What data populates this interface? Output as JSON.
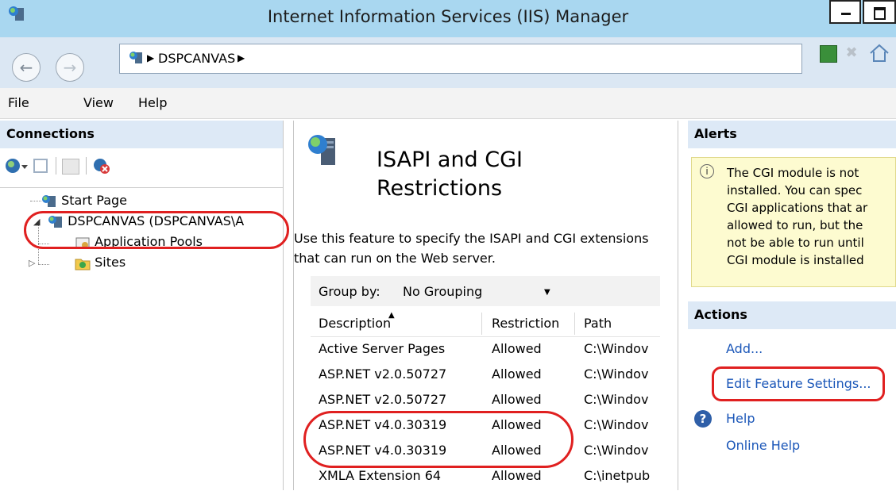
{
  "window": {
    "title": "Internet Information Services (IIS) Manager"
  },
  "address": {
    "segment": "DSPCANVAS"
  },
  "menu": [
    "File",
    "View",
    "Help"
  ],
  "connections": {
    "header": "Connections",
    "tree": {
      "start_page": "Start Page",
      "server": "DSPCANVAS (DSPCANVAS\\A",
      "app_pools": "Application Pools",
      "sites": "Sites"
    }
  },
  "feature": {
    "title_line1": "ISAPI and CGI",
    "title_line2": "Restrictions",
    "description": "Use this feature to specify the ISAPI and CGI extensions that can run on the Web server.",
    "group_by_label": "Group by:",
    "group_by_value": "No Grouping",
    "columns": [
      "Description",
      "Restriction",
      "Path"
    ],
    "rows": [
      [
        "Active Server Pages",
        "Allowed",
        "C:\\Windov"
      ],
      [
        "ASP.NET v2.0.50727",
        "Allowed",
        "C:\\Windov"
      ],
      [
        "ASP.NET v2.0.50727",
        "Allowed",
        "C:\\Windov"
      ],
      [
        "ASP.NET v4.0.30319",
        "Allowed",
        "C:\\Windov"
      ],
      [
        "ASP.NET v4.0.30319",
        "Allowed",
        "C:\\Windov"
      ],
      [
        "XMLA Extension 64",
        "Allowed",
        "C:\\inetpub"
      ]
    ]
  },
  "alerts": {
    "header": "Alerts",
    "lines": [
      "The CGI module is not",
      "installed. You can spec",
      "CGI applications that ar",
      "allowed to run, but the",
      "not be able to run until",
      "CGI module is installed"
    ]
  },
  "actions": {
    "header": "Actions",
    "add": "Add...",
    "edit": "Edit Feature Settings...",
    "help": "Help",
    "online_help": "Online Help"
  },
  "colors": {
    "annotation": "#e02020",
    "link": "#1a56b8",
    "alert_bg": "#fdfbd0"
  }
}
